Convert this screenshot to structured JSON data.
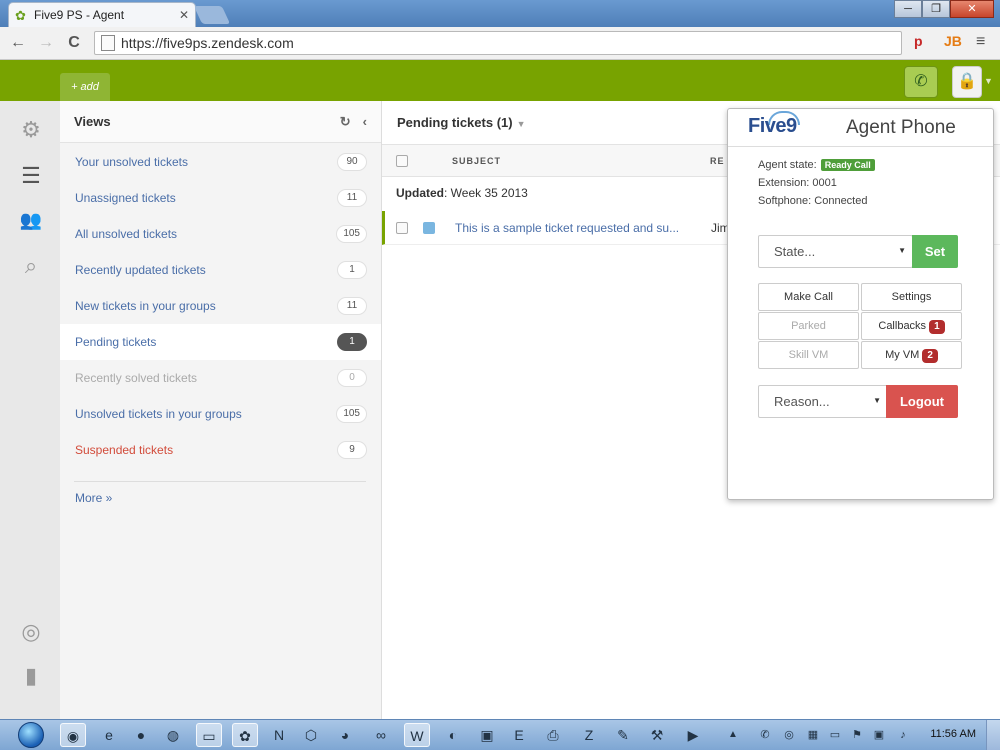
{
  "browser": {
    "tab_title": "Five9 PS - Agent",
    "tab_close": "✕",
    "url": "https://five9ps.zendesk.com",
    "window_controls": {
      "minimize": "─",
      "maximize": "❐",
      "close": "✕"
    },
    "nav": {
      "back": "←",
      "forward": "→",
      "reload": "C"
    },
    "extensions": {
      "ext1": "p",
      "ext2": "JB",
      "menu": "≡"
    }
  },
  "app_header": {
    "add_label": "+ add",
    "phone_icon": "phone-icon",
    "user_icon": "lock-icon"
  },
  "rail": {
    "icons": [
      "gear-icon",
      "list-icon",
      "users-icon",
      "search-icon",
      "globe-icon",
      "bar-chart-icon"
    ]
  },
  "views": {
    "title": "Views",
    "items": [
      {
        "label": "Your unsolved tickets",
        "count": "90"
      },
      {
        "label": "Unassigned tickets",
        "count": "11"
      },
      {
        "label": "All unsolved tickets",
        "count": "105"
      },
      {
        "label": "Recently updated tickets",
        "count": "1"
      },
      {
        "label": "New tickets in your groups",
        "count": "11"
      },
      {
        "label": "Pending tickets",
        "count": "1"
      },
      {
        "label": "Recently solved tickets",
        "count": "0"
      },
      {
        "label": "Unsolved tickets in your groups",
        "count": "105"
      },
      {
        "label": "Suspended tickets",
        "count": "9"
      }
    ],
    "more": "More »"
  },
  "main": {
    "title": "Pending tickets (1)",
    "columns": {
      "subject": "SUBJECT",
      "requester": "RE"
    },
    "group": {
      "label": "Updated",
      "value": ": Week 35 2013"
    },
    "tickets": [
      {
        "subject": "This is a sample ticket requested and su...",
        "requester": "Jim"
      }
    ]
  },
  "agent_phone": {
    "logo": "Five9",
    "title": "Agent Phone",
    "agent_state_label": "Agent state:",
    "agent_state_value": "Ready Call",
    "extension": "Extension: 0001",
    "softphone": "Softphone: Connected",
    "state_select": "State...",
    "set_button": "Set",
    "buttons": {
      "make_call": "Make Call",
      "settings": "Settings",
      "parked": "Parked",
      "callbacks": "Callbacks",
      "callbacks_count": "1",
      "skill_vm": "Skill VM",
      "my_vm": "My VM",
      "my_vm_count": "2"
    },
    "reason_select": "Reason...",
    "logout_button": "Logout"
  },
  "taskbar": {
    "clock": "11:56 AM"
  },
  "colors": {
    "brand_green": "#78a300",
    "link_blue": "#4a6ea8",
    "set_green": "#5cb85c",
    "logout_red": "#d9534f",
    "danger_text": "#d24b3a"
  }
}
